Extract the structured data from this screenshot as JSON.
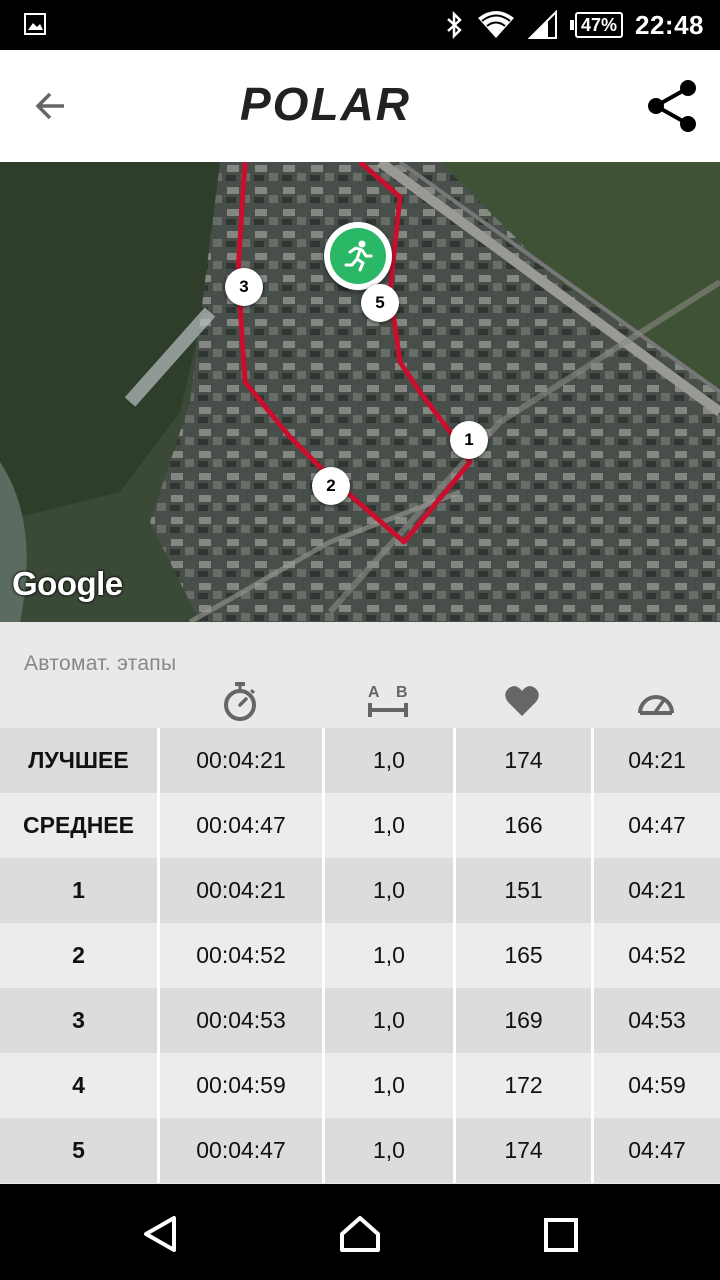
{
  "status_bar": {
    "battery": "47%",
    "time": "22:48"
  },
  "app_bar": {
    "logo_text": "POLAR"
  },
  "map": {
    "attribution": "Google",
    "lap_markers": [
      "1",
      "2",
      "3",
      "5"
    ],
    "route_color": "#c8102e",
    "sport_color": "#2ab766"
  },
  "laps": {
    "title": "Автомат. этапы",
    "columns": [
      "duration-icon",
      "distance-icon",
      "heart-rate-icon",
      "pace-icon"
    ],
    "rows": [
      {
        "label": "ЛУЧШЕЕ",
        "time": "00:04:21",
        "distance": "1,0",
        "hr": "174",
        "pace": "04:21"
      },
      {
        "label": "СРЕДНЕЕ",
        "time": "00:04:47",
        "distance": "1,0",
        "hr": "166",
        "pace": "04:47"
      },
      {
        "label": "1",
        "time": "00:04:21",
        "distance": "1,0",
        "hr": "151",
        "pace": "04:21"
      },
      {
        "label": "2",
        "time": "00:04:52",
        "distance": "1,0",
        "hr": "165",
        "pace": "04:52"
      },
      {
        "label": "3",
        "time": "00:04:53",
        "distance": "1,0",
        "hr": "169",
        "pace": "04:53"
      },
      {
        "label": "4",
        "time": "00:04:59",
        "distance": "1,0",
        "hr": "172",
        "pace": "04:59"
      },
      {
        "label": "5",
        "time": "00:04:47",
        "distance": "1,0",
        "hr": "174",
        "pace": "04:47"
      }
    ]
  }
}
